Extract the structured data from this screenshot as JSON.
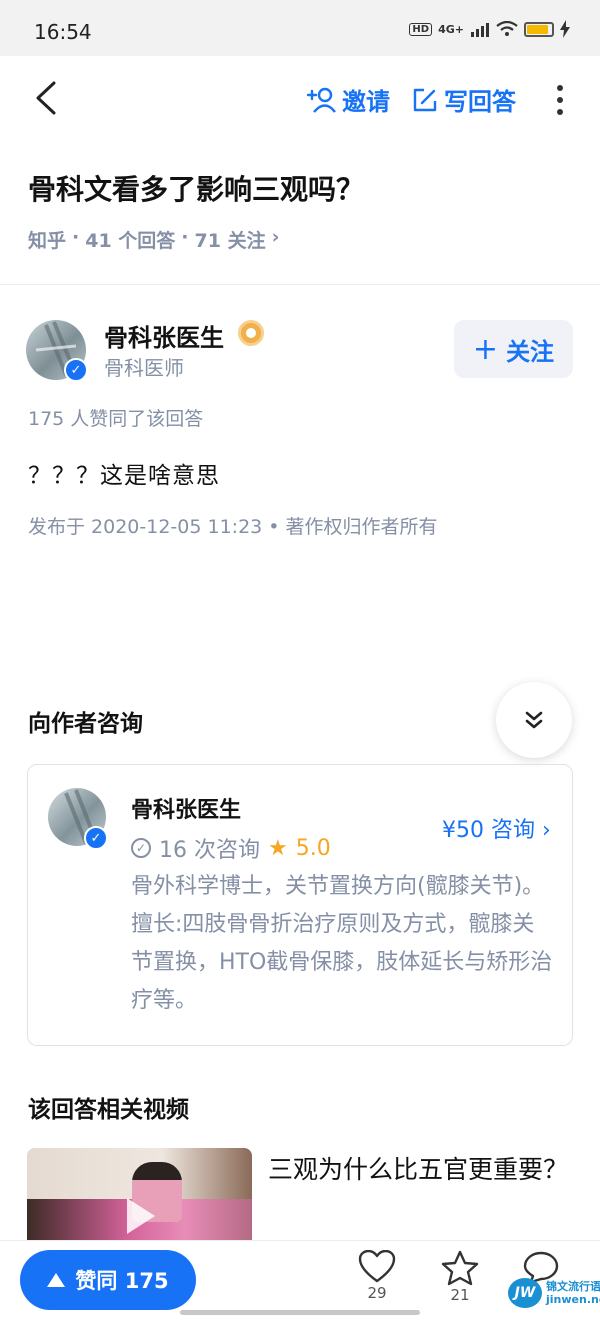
{
  "status_bar": {
    "time": "16:54",
    "hd": "HD",
    "network": "4G+"
  },
  "nav": {
    "invite_label": "邀请",
    "write_label": "写回答"
  },
  "question": {
    "title": "骨科文看多了影响三观吗？",
    "source": "知乎",
    "answers": "41 个回答",
    "followers": "71 关注",
    "sep": "·",
    "chevron": "›"
  },
  "author": {
    "name": "骨科张医生",
    "title": "骨科医师",
    "follow_label": "关注",
    "follow_plus": "+"
  },
  "answer": {
    "likes_text": "175 人赞同了该回答",
    "content": "？？？这是啥意思",
    "publish_text": "发布于 2020-12-05 11:23 • 著作权归作者所有"
  },
  "consult": {
    "heading": "向作者咨询",
    "doctor_name": "骨科张医生",
    "price_label": "¥50 咨询 ›",
    "consult_count": "16 次咨询",
    "rating": "5.0",
    "description": "骨外科学博士，关节置换方向(髋膝关节)。擅长:四肢骨骨折治疗原则及方式，髋膝关节置换，HTO截骨保膝，肢体延长与矫形治疗等。"
  },
  "related": {
    "heading": "该回答相关视频",
    "video_title": "三观为什么比五官更重要？"
  },
  "bottom_bar": {
    "agree_label": "赞同 175",
    "heart_count": "29",
    "star_count": "21"
  },
  "watermark": {
    "logo": "JW",
    "line1": "锦文流行语",
    "line2": "jinwen.net"
  },
  "colors": {
    "accent": "#1772f6",
    "muted": "#8590a6",
    "rating": "#f5a623"
  },
  "icons": [
    "back-arrow-icon",
    "add-user-icon",
    "edit-icon",
    "more-vertical-icon",
    "verified-icon",
    "medal-icon",
    "double-chevron-down-icon",
    "check-circle-icon",
    "star-icon",
    "play-icon",
    "heart-icon",
    "comment-icon"
  ]
}
